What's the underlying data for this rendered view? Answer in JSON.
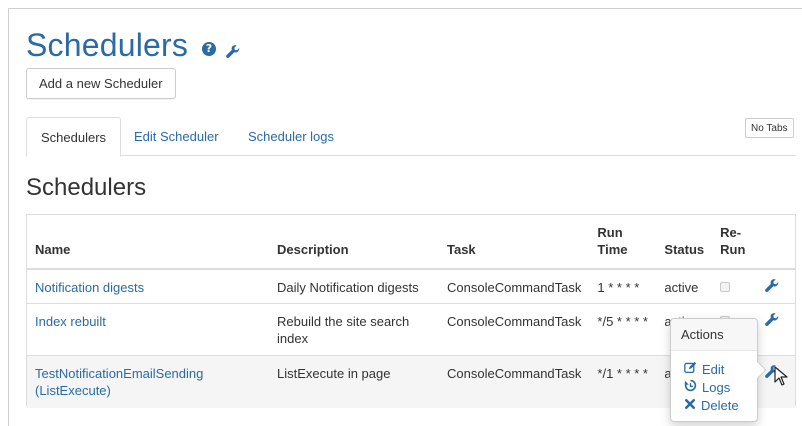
{
  "header": {
    "title": "Schedulers",
    "help_icon": "?",
    "icons": [
      "help-icon",
      "wrench-icon"
    ]
  },
  "toolbar": {
    "add_label": "Add a new Scheduler"
  },
  "tabs": [
    {
      "label": "Schedulers",
      "active": true
    },
    {
      "label": "Edit Scheduler",
      "active": false
    },
    {
      "label": "Scheduler logs",
      "active": false
    }
  ],
  "no_tabs_label": "No Tabs",
  "section_title": "Schedulers",
  "table": {
    "headers": {
      "name": "Name",
      "description": "Description",
      "task": "Task",
      "run_time_1": "Run",
      "run_time_2": "Time",
      "status": "Status",
      "rerun_1": "Re-",
      "rerun_2": "Run"
    },
    "rows": [
      {
        "name": "Notification digests",
        "description": "Daily Notification digests",
        "task": "ConsoleCommandTask",
        "run_time": "1 * * * *",
        "status": "active",
        "rerun": false
      },
      {
        "name": "Index rebuilt",
        "description": "Rebuild the site search index",
        "task": "ConsoleCommandTask",
        "run_time": "*/5 * * * *",
        "status": "active",
        "rerun": false
      },
      {
        "name": "TestNotificationEmailSending (ListExecute)",
        "description": "ListExecute in page",
        "task": "ConsoleCommandTask",
        "run_time": "*/1 * * * *",
        "status": "active",
        "rerun": false
      }
    ]
  },
  "actions_popover": {
    "title": "Actions",
    "items": [
      {
        "label": "Edit",
        "icon": "edit-icon"
      },
      {
        "label": "Logs",
        "icon": "history-icon"
      },
      {
        "label": "Delete",
        "icon": "delete-icon"
      }
    ]
  },
  "colors": {
    "link": "#2a6aa6",
    "text": "#333333",
    "border": "#dddddd",
    "row_hover": "#f5f5f5"
  }
}
